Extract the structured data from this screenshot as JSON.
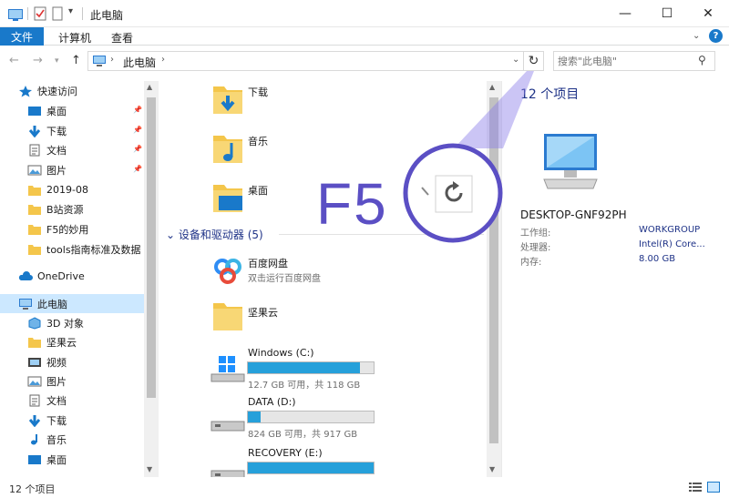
{
  "window": {
    "title": "此电脑",
    "minimize_glyph": "—",
    "maximize_glyph": "☐",
    "close_glyph": "✕"
  },
  "ribbon": {
    "tabs": [
      {
        "label": "文件"
      },
      {
        "label": "计算机"
      },
      {
        "label": "查看"
      }
    ],
    "help_glyph": "?"
  },
  "address": {
    "path": "此电脑",
    "search_placeholder": "搜索\"此电脑\""
  },
  "colors": {
    "accent": "#1979ca",
    "selected_bg": "#cce8ff",
    "link_text": "#1e3287",
    "drive_bar_fill": "#26a0da",
    "annotation": "#5b4fc4",
    "folder_yellow": "#f4c64b"
  },
  "nav": {
    "items": [
      {
        "label": "快速访问",
        "icon": "star-icon"
      },
      {
        "label": "桌面",
        "icon": "desktop-icon",
        "pinned": true
      },
      {
        "label": "下载",
        "icon": "download-icon",
        "pinned": true
      },
      {
        "label": "文档",
        "icon": "document-icon",
        "pinned": true
      },
      {
        "label": "图片",
        "icon": "picture-icon",
        "pinned": true
      },
      {
        "label": "2019-08",
        "icon": "folder-icon"
      },
      {
        "label": "B站资源",
        "icon": "folder-icon"
      },
      {
        "label": "F5的妙用",
        "icon": "folder-icon"
      },
      {
        "label": "tools指南标准及数据",
        "icon": "folder-icon"
      },
      {
        "label": "OneDrive",
        "icon": "cloud-icon"
      },
      {
        "label": "此电脑",
        "icon": "computer-icon",
        "selected": true
      },
      {
        "label": "3D 对象",
        "icon": "cube-icon"
      },
      {
        "label": "坚果云",
        "icon": "folder-icon"
      },
      {
        "label": "视频",
        "icon": "video-icon"
      },
      {
        "label": "图片",
        "icon": "picture-icon"
      },
      {
        "label": "文档",
        "icon": "document-icon"
      },
      {
        "label": "下载",
        "icon": "download-icon"
      },
      {
        "label": "音乐",
        "icon": "music-icon"
      },
      {
        "label": "桌面",
        "icon": "desktop-icon"
      }
    ]
  },
  "content": {
    "folders": [
      {
        "label": "下载",
        "icon": "download-folder-icon"
      },
      {
        "label": "音乐",
        "icon": "music-folder-icon"
      },
      {
        "label": "桌面",
        "icon": "desktop-folder-icon"
      }
    ],
    "devices_header": "设备和驱动器 (5)",
    "devices": [
      {
        "label": "百度网盘",
        "sub": "双击运行百度网盘",
        "icon": "baidu-netdisk-icon"
      },
      {
        "label": "坚果云",
        "icon": "folder-icon"
      }
    ],
    "drives": [
      {
        "label": "Windows (C:)",
        "sub": "12.7 GB 可用，共 118 GB",
        "used_fraction": 0.89,
        "icon": "windows-drive-icon"
      },
      {
        "label": "DATA (D:)",
        "sub": "824 GB 可用，共 917 GB",
        "used_fraction": 0.1,
        "icon": "drive-icon"
      },
      {
        "label": "RECOVERY (E:)",
        "used_fraction": 1.0,
        "icon": "drive-icon"
      }
    ]
  },
  "details": {
    "count": "12 个项目",
    "computer_name": "DESKTOP-GNF92PH",
    "rows": [
      {
        "key": "工作组:",
        "value": "WORKGROUP"
      },
      {
        "key": "处理器:",
        "value": "Intel(R) Core..."
      },
      {
        "key": "内存:",
        "value": "8.00 GB"
      }
    ]
  },
  "status": {
    "count": "12 个项目"
  },
  "annotation": {
    "label": "F5"
  }
}
